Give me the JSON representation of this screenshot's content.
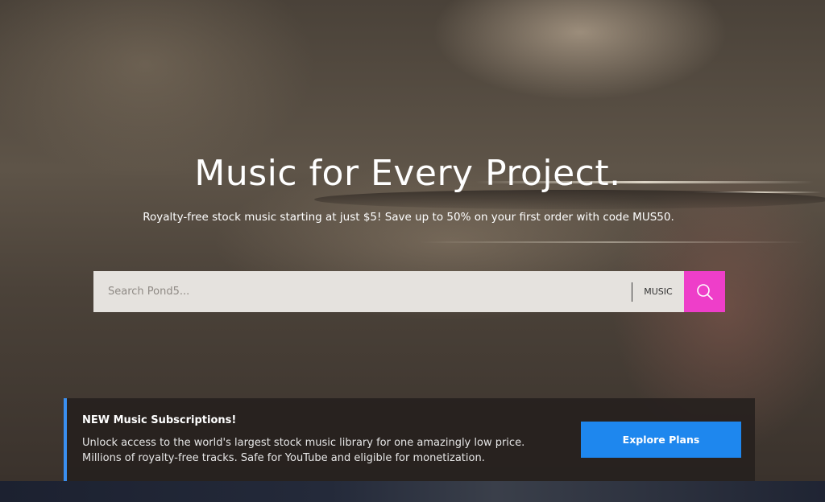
{
  "hero": {
    "title": "Music for Every Project.",
    "subtitle": "Royalty-free stock music starting at just $5! Save up to 50% on your first order with code MUS50."
  },
  "search": {
    "placeholder": "Search Pond5...",
    "category": "MUSIC",
    "button_icon": "search-icon",
    "button_color": "#ee3ec9"
  },
  "banner": {
    "title": "NEW Music Subscriptions!",
    "line1": "Unlock access to the world's largest stock music library for one amazingly low price.",
    "line2": "Millions of royalty-free tracks. Safe for YouTube and eligible for monetization.",
    "button_label": "Explore Plans",
    "accent_color": "#3a8ff0",
    "button_color": "#1e87ee"
  }
}
